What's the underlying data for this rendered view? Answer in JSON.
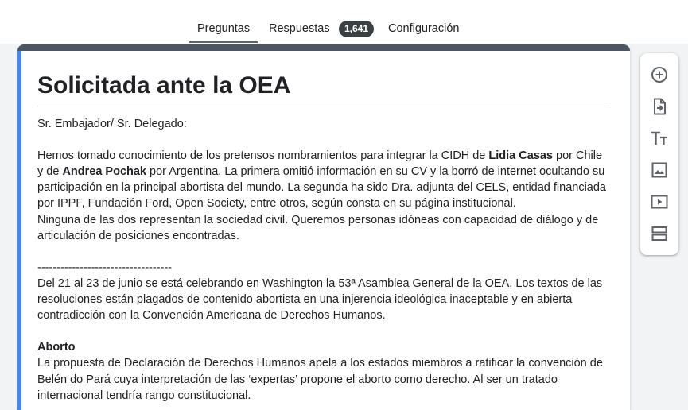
{
  "tabs": {
    "questions": "Preguntas",
    "responses": "Respuestas",
    "responses_count": "1,641",
    "settings": "Configuración"
  },
  "form": {
    "title": "Solicitada ante la OEA",
    "greeting": "Sr. Embajador/ Sr. Delegado:",
    "p1_a": "Hemos tomado conocimiento de los pretensos nombramientos para integrar la CIDH de ",
    "p1_name1": "Lidia Casas",
    "p1_b": " por Chile",
    "p1_c": "y de ",
    "p1_name2": "Andrea Pochak",
    "p1_d": " por Argentina. La primera omitió información en su CV y la borró de internet ocultando su",
    "p1_e": "participación en la principal abortista del mundo. La segunda ha sido Dra. adjunta del CELS, entidad financiada",
    "p1_f": "por IPPF, Fundación Ford, Open Society, entre otros, según consta en su página institucional.",
    "p2_a": "Ninguna de las dos representan la sociedad civil. Queremos personas idóneas con capacidad de diálogo y de",
    "p2_b": "articulación de posiciones encontradas.",
    "separator": "-----------------------------------",
    "p3_a": "Del 21 al 23 de junio se está celebrando en Washington la 53ª Asamblea General de la OEA. Los textos de las",
    "p3_b": "resoluciones están plagados de contenido abortista en una injerencia ideológica inaceptable y en abierta",
    "p3_c": "contradicción con la Convención Americana de Derechos Humanos.",
    "section_heading": "Aborto",
    "p4_a": "La propuesta de Declaración de Derechos Humanos apela a los estados miembros a ratificar la convención de",
    "p4_b": "Belén do Pará cuya interpretación de las ‘expertas’ propone el aborto como derecho. Al ser un tratado",
    "p4_c": "internacional tendría rango constitucional."
  },
  "toolbar_icons": [
    "add-question-icon",
    "import-questions-icon",
    "add-title-icon",
    "add-image-icon",
    "add-video-icon",
    "add-section-icon"
  ],
  "colors": {
    "accent_left": "#4285f4",
    "card_header": "#4b5563",
    "badge_bg": "#3c4043",
    "icon": "#5f6368"
  }
}
